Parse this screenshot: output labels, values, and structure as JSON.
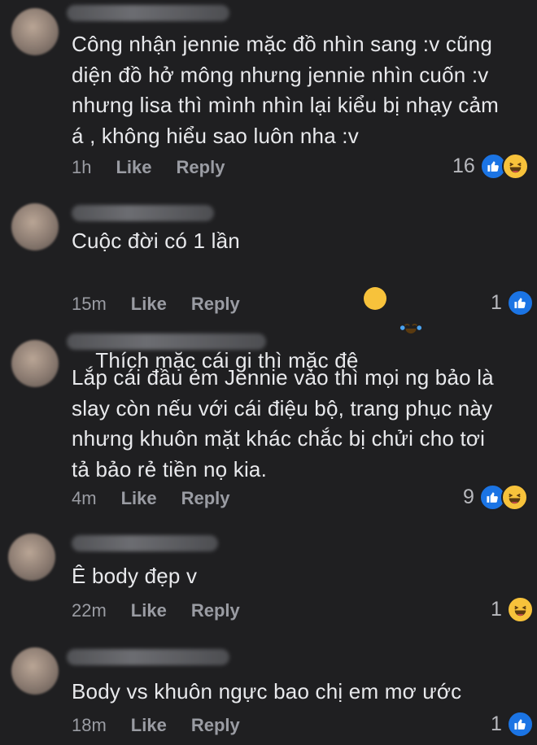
{
  "comments": [
    {
      "lines": [
        "Công nhận jennie mặc đồ nhìn sang :v cũng",
        "diện đồ hở mông nhưng jennie nhìn cuốn :v",
        "nhưng lisa thì mình nhìn lại kiểu bị nhạy cảm",
        "á , không hiểu sao luôn nha :v"
      ],
      "time": "1h",
      "like": "Like",
      "reply": "Reply",
      "reaction_count": "16",
      "reactions": [
        "like-icon",
        "haha-icon"
      ]
    },
    {
      "lines": [
        "Cuộc đời có 1 lần",
        "Thích mặc cái gi thì mặc đê"
      ],
      "inline_emoji": "laughing-tears-emoji",
      "time": "15m",
      "like": "Like",
      "reply": "Reply",
      "reaction_count": "1",
      "reactions": [
        "like-icon"
      ]
    },
    {
      "lines": [
        "Lắp cái đầu ẻm Jennie vào thì mọi ng bảo là",
        "slay còn nếu với cái điệu bộ, trang phục này",
        "nhưng khuôn mặt khác chắc bị chửi cho tơi",
        "tả bảo rẻ tiền nọ kia."
      ],
      "time": "4m",
      "like": "Like",
      "reply": "Reply",
      "reaction_count": "9",
      "reactions": [
        "like-icon",
        "haha-icon"
      ]
    },
    {
      "lines": [
        "Ê body đẹp v"
      ],
      "time": "22m",
      "like": "Like",
      "reply": "Reply",
      "reaction_count": "1",
      "reactions": [
        "haha-icon"
      ]
    },
    {
      "lines": [
        "Body vs khuôn ngực bao chị em mơ ước"
      ],
      "time": "18m",
      "like": "Like",
      "reply": "Reply",
      "reaction_count": "1",
      "reactions": [
        "like-icon"
      ]
    }
  ],
  "colors": {
    "background": "#1f1f21",
    "like_blue": "#1b74e4",
    "haha_yellow": "#f7c23b",
    "meta_gray": "#9a9ca3"
  }
}
